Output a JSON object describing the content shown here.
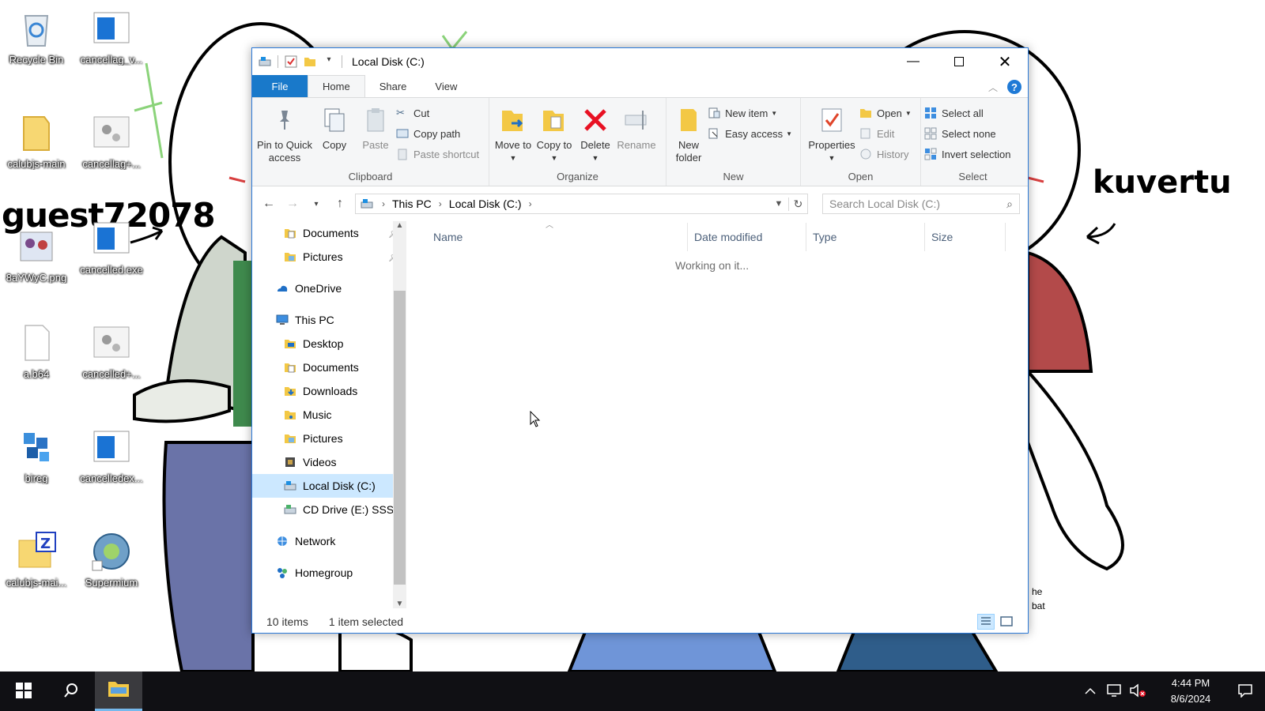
{
  "wallpaper": {
    "caption_left": "guest72078",
    "caption_right": "kuvertu",
    "peek_lines": [
      "he",
      "bat"
    ]
  },
  "desktop_icons": [
    {
      "label": "Recycle Bin",
      "icon": "recycle-bin-icon"
    },
    {
      "label": "cancellag_v...",
      "icon": "window-app-icon"
    },
    {
      "label": "calubjs-main",
      "icon": "folder-icon"
    },
    {
      "label": "cancellag+...",
      "icon": "gear-file-icon"
    },
    {
      "label": "8aYWyC.png",
      "icon": "image-file-icon"
    },
    {
      "label": "cancelled.exe",
      "icon": "window-app-icon"
    },
    {
      "label": "a.b64",
      "icon": "blank-file-icon"
    },
    {
      "label": "cancelled+...",
      "icon": "gear-file-icon"
    },
    {
      "label": "bireg",
      "icon": "registry-cubes-icon"
    },
    {
      "label": "cancelledex...",
      "icon": "window-app-icon"
    },
    {
      "label": "calubjs-mai...",
      "icon": "zip-folder-icon"
    },
    {
      "label": "Supermium",
      "icon": "browser-globe-icon"
    }
  ],
  "window": {
    "title": "Local Disk (C:)",
    "tabs": [
      "File",
      "Home",
      "Share",
      "View"
    ],
    "active_tab": "Home"
  },
  "ribbon": {
    "clipboard": {
      "name": "Clipboard",
      "pin": "Pin to Quick access",
      "copy": "Copy",
      "paste": "Paste",
      "cut": "Cut",
      "copy_path": "Copy path",
      "paste_shortcut": "Paste shortcut"
    },
    "organize": {
      "name": "Organize",
      "move_to": "Move to",
      "copy_to": "Copy to",
      "delete": "Delete",
      "rename": "Rename"
    },
    "new": {
      "name": "New",
      "new_folder": "New folder",
      "new_item": "New item",
      "easy_access": "Easy access"
    },
    "open": {
      "name": "Open",
      "properties": "Properties",
      "open": "Open",
      "edit": "Edit",
      "history": "History"
    },
    "select": {
      "name": "Select",
      "select_all": "Select all",
      "select_none": "Select none",
      "invert": "Invert selection"
    }
  },
  "address": {
    "crumbs": [
      "This PC",
      "Local Disk (C:)"
    ],
    "search_placeholder": "Search Local Disk (C:)"
  },
  "nav": {
    "items": [
      {
        "label": "Documents",
        "level": 2,
        "icon": "documents-icon",
        "pinned": true
      },
      {
        "label": "Pictures",
        "level": 2,
        "icon": "pictures-icon",
        "pinned": true
      },
      {
        "label": "OneDrive",
        "level": 1,
        "icon": "onedrive-cloud-icon"
      },
      {
        "label": "This PC",
        "level": 1,
        "icon": "this-pc-icon"
      },
      {
        "label": "Desktop",
        "level": 2,
        "icon": "desktop-folder-icon"
      },
      {
        "label": "Documents",
        "level": 2,
        "icon": "documents-icon"
      },
      {
        "label": "Downloads",
        "level": 2,
        "icon": "downloads-icon"
      },
      {
        "label": "Music",
        "level": 2,
        "icon": "music-icon"
      },
      {
        "label": "Pictures",
        "level": 2,
        "icon": "pictures-icon"
      },
      {
        "label": "Videos",
        "level": 2,
        "icon": "videos-icon"
      },
      {
        "label": "Local Disk (C:)",
        "level": 2,
        "icon": "local-disk-icon",
        "selected": true
      },
      {
        "label": "CD Drive (E:) SSS",
        "level": 2,
        "icon": "cd-drive-icon"
      },
      {
        "label": "Network",
        "level": 1,
        "icon": "network-icon"
      },
      {
        "label": "Homegroup",
        "level": 1,
        "icon": "homegroup-icon"
      }
    ]
  },
  "content": {
    "columns": [
      "Name",
      "Date modified",
      "Type",
      "Size"
    ],
    "loading_text": "Working on it..."
  },
  "status": {
    "item_count": "10 items",
    "selection": "1 item selected"
  },
  "taskbar": {
    "time": "4:44 PM",
    "date": "8/6/2024"
  },
  "colors": {
    "accent": "#1979ca",
    "selection": "#cce8ff",
    "taskbar": "#101014",
    "delete_red": "#e81123"
  }
}
